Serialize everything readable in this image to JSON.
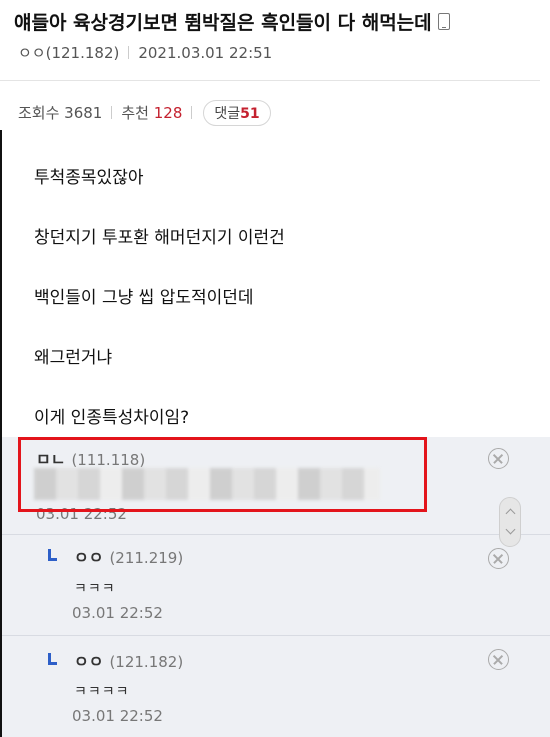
{
  "post": {
    "title": "얘들아 육상경기보면 뜀박질은 흑인들이 다 해먹는데",
    "author": "ㅇㅇ(121.182)",
    "datetime": "2021.03.01 22:51",
    "views_label": "조회수 3681",
    "recommend_label": "추천",
    "recommend_count": "128",
    "comment_label": "댓글",
    "comment_count": "51",
    "body": [
      "투척종목있잖아",
      "창던지기 투포환 해머던지기 이런건",
      "백인들이 그냥 씹 압도적이던데",
      "왜그런거냐",
      "이게 인종특성차이임?"
    ]
  },
  "comments": [
    {
      "author": "ㅁㄴ",
      "ip": "(111.118)",
      "text": "",
      "date": "03.01 22:52"
    },
    {
      "author": "ㅇㅇ",
      "ip": "(211.219)",
      "text": "ㅋㅋㅋ",
      "date": "03.01 22:52"
    },
    {
      "author": "ㅇㅇ",
      "ip": "(121.182)",
      "text": "ㅋㅋㅋㅋ",
      "date": "03.01 22:52"
    }
  ],
  "icons": {
    "mobile": "mobile-icon",
    "delete": "close-icon",
    "reply": "reply-arrow-icon",
    "scroll": "scroll-handle-icon"
  },
  "colors": {
    "accent_red": "#c4212f",
    "highlight_box": "#e3141b",
    "reply_arrow": "#2d5fc8",
    "comment_bg": "#eef0f4"
  }
}
